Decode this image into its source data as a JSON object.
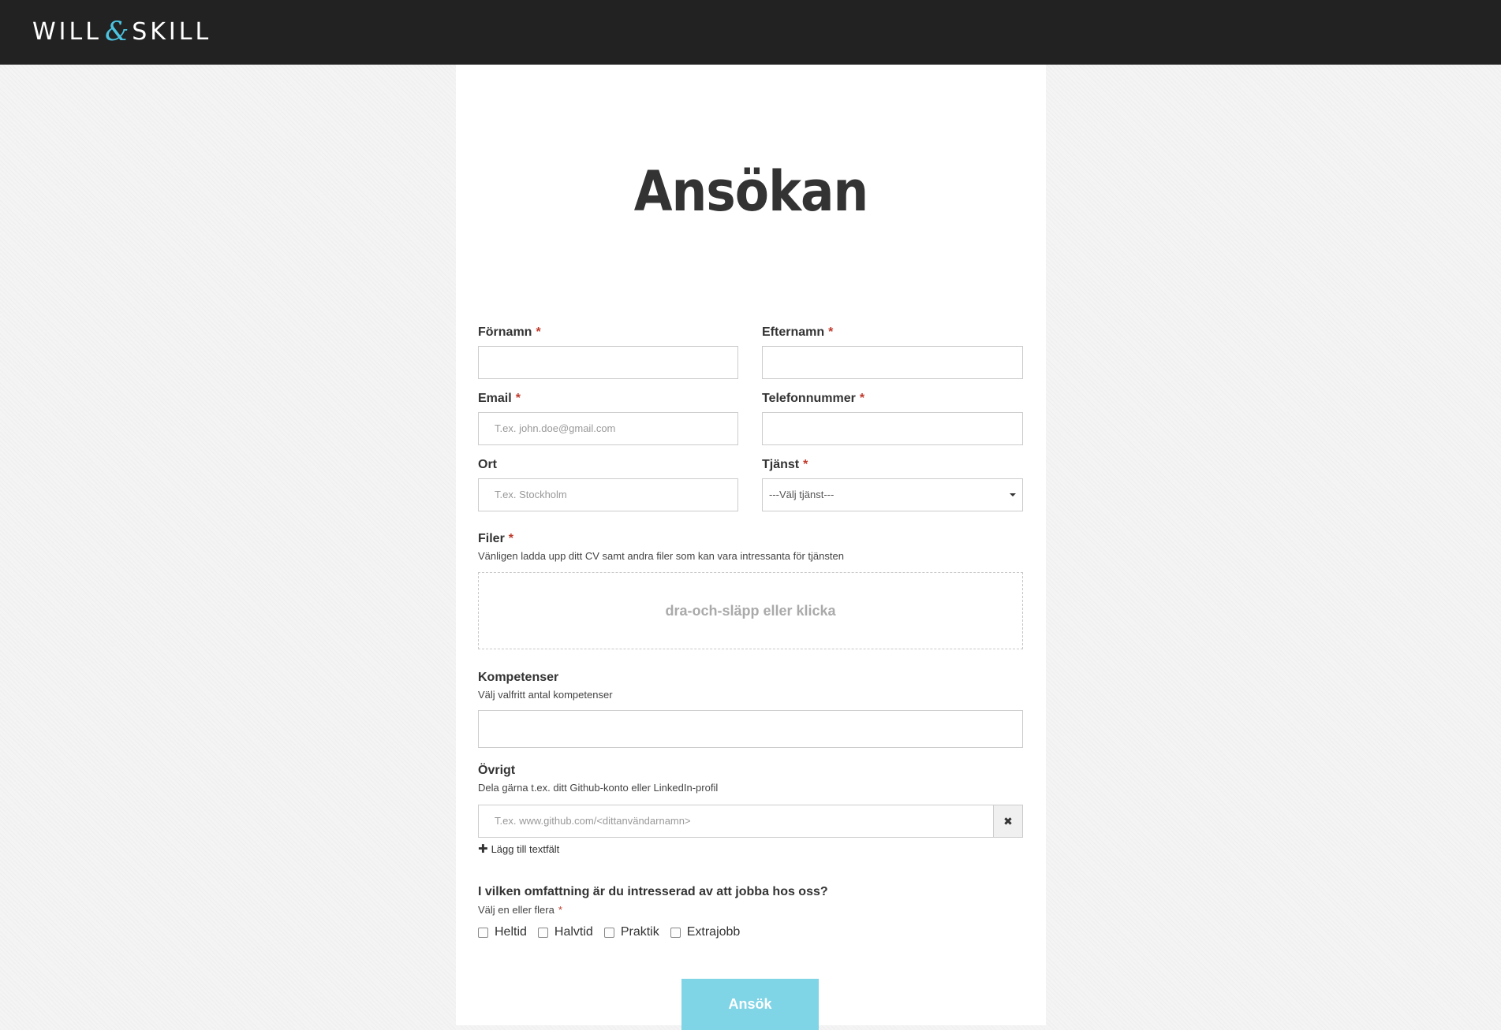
{
  "header": {
    "logo": {
      "left": "WILL",
      "amp": "&",
      "right": "SKILL"
    }
  },
  "form": {
    "title": "Ansökan",
    "required_marker": "*",
    "fornamn": {
      "label": "Förnamn",
      "value": ""
    },
    "efternamn": {
      "label": "Efternamn",
      "value": ""
    },
    "email": {
      "label": "Email",
      "placeholder": "T.ex. john.doe@gmail.com"
    },
    "telefon": {
      "label": "Telefonnummer",
      "value": ""
    },
    "ort": {
      "label": "Ort",
      "placeholder": "T.ex. Stockholm"
    },
    "tjanst": {
      "label": "Tjänst",
      "selected": "---Välj tjänst---"
    },
    "filer": {
      "label": "Filer",
      "hint": "Vänligen ladda upp ditt CV samt andra filer som kan vara intressanta för tjänsten",
      "dropzone_text": "dra-och-släpp eller klicka"
    },
    "kompetenser": {
      "label": "Kompetenser",
      "hint": "Välj valfritt antal kompetenser"
    },
    "ovrigt": {
      "label": "Övrigt",
      "hint": "Dela gärna t.ex. ditt Github-konto eller LinkedIn-profil",
      "placeholder": "T.ex. www.github.com/<dittanvändarnamn>",
      "clear_icon": "close-icon",
      "add_field": "Lägg till textfält"
    },
    "omfattning": {
      "question": "I vilken omfattning är du intresserad av att jobba hos oss?",
      "hint": "Välj en eller flera",
      "options": [
        "Heltid",
        "Halvtid",
        "Praktik",
        "Extrajobb"
      ]
    },
    "submit_label": "Ansök"
  },
  "colors": {
    "topbar": "#222222",
    "accent": "#7fd4e6",
    "required": "#c0392b"
  }
}
